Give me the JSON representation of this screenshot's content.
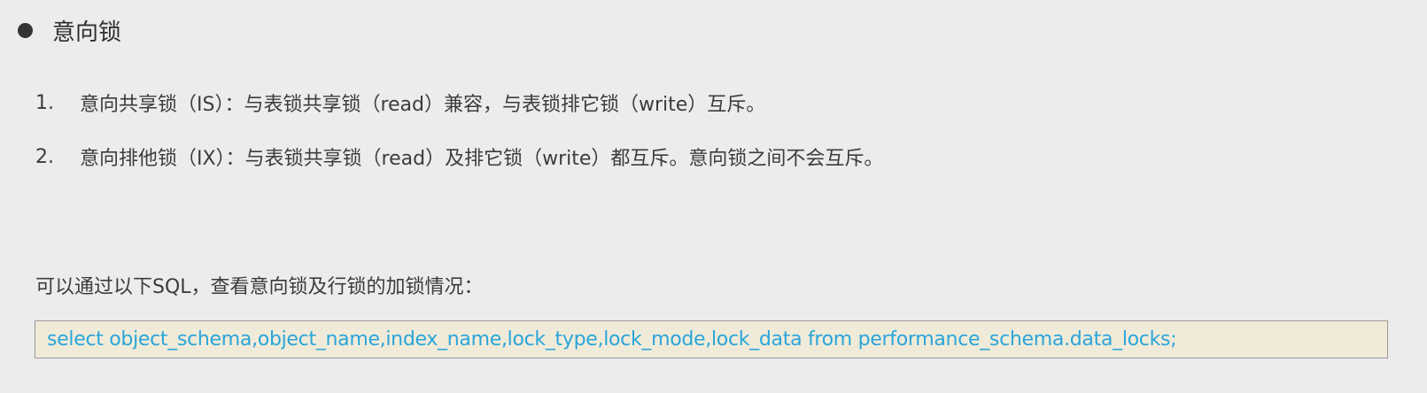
{
  "section": {
    "title": "意向锁"
  },
  "items": [
    {
      "number": "1.",
      "text": "意向共享锁（IS）：与表锁共享锁（read）兼容，与表锁排它锁（write）互斥。"
    },
    {
      "number": "2.",
      "text": "意向排他锁（IX）：与表锁共享锁（read）及排它锁（write）都互斥。意向锁之间不会互斥。"
    }
  ],
  "note": "可以通过以下SQL，查看意向锁及行锁的加锁情况：",
  "code": "select object_schema,object_name,index_name,lock_type,lock_mode,lock_data from performance_schema.data_locks;",
  "colors": {
    "background": "#ececec",
    "code_background": "#f0ebd9",
    "code_text": "#2aa5d9"
  }
}
